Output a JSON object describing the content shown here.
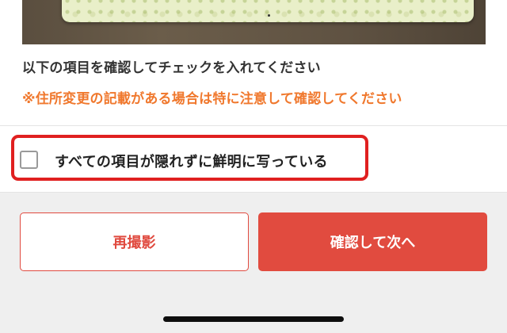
{
  "verification": {
    "instruction": "以下の項目を確認してチェックを入れてください",
    "warning": "※住所変更の記載がある場合は特に注意して確認してください",
    "checkbox_label": "すべての項目が隠れずに鮮明に写っている",
    "checkbox_checked": false
  },
  "actions": {
    "retake_label": "再撮影",
    "confirm_label": "確認して次へ"
  },
  "colors": {
    "accent": "#e14b3f",
    "warning": "#f0782d",
    "highlight": "#e02020"
  }
}
